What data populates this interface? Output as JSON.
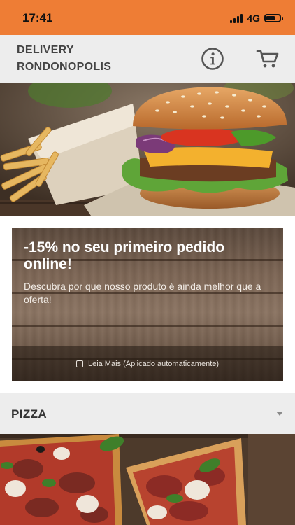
{
  "status_bar": {
    "time": "17:41",
    "network": "4G",
    "battery_level": 0.65
  },
  "header": {
    "brand_line1": "DELIVERY",
    "brand_line2": "RONDONOPOLIS",
    "info_icon": "info-circle-icon",
    "cart_icon": "shopping-cart-icon"
  },
  "hero": {
    "image": "burger-and-fries-photo"
  },
  "promo": {
    "title": "-15% no seu primeiro pedido online!",
    "description": "Descubra por que nosso produto é ainda melhor que a oferta!",
    "more_label": "Leia Mais (Aplicado automaticamente)",
    "more_icon": "tag-icon"
  },
  "category": {
    "name": "PIZZA",
    "toggle_icon": "chevron-down-icon",
    "image": "pizza-photo"
  },
  "colors": {
    "status_bar": "#ee7d35",
    "header_bg": "#ededed",
    "text_dark": "#444444"
  }
}
